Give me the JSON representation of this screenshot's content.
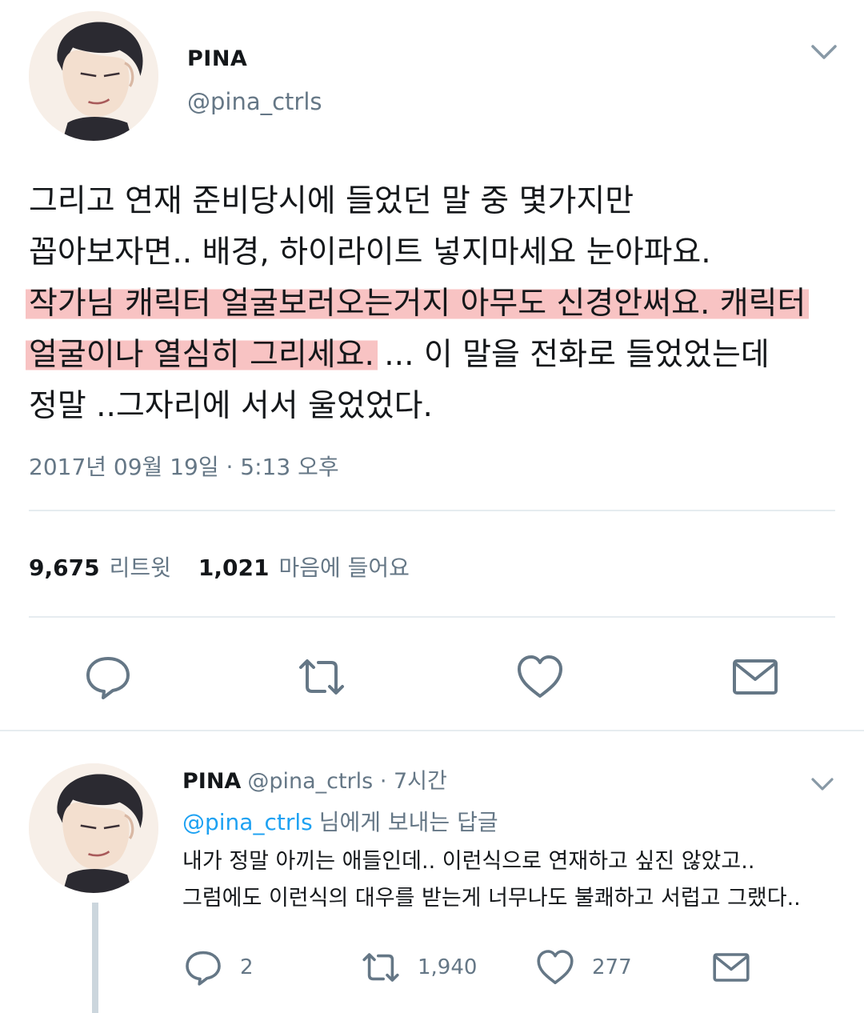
{
  "tweet": {
    "author_name": "PINA",
    "author_handle": "@pina_ctrls",
    "text_lines": [
      {
        "before": "그리고 연재 준비당시에 들었던 말 중 몇가지만",
        "marked": "",
        "after": ""
      },
      {
        "before": "꼽아보자면.. 배경, 하이라이트 넣지마세요 눈아파요.",
        "marked": "",
        "after": ""
      },
      {
        "before": "",
        "marked": "작가님 캐릭터 얼굴보러오는거지 아무도 신경안써요. 캐릭터",
        "after": ""
      },
      {
        "before": "",
        "marked": "얼굴이나 열심히 그리세요.",
        "after": " ... 이 말을 전화로 들었었는데"
      },
      {
        "before": "정말 ..그자리에 서서 울었었다.",
        "marked": "",
        "after": ""
      }
    ],
    "timestamp": "2017년 09월 19일 · 5:13 오후",
    "retweet_count": "9,675",
    "retweet_label": "리트윗",
    "like_count": "1,021",
    "like_label": "마음에 들어요",
    "icons": {
      "menu": "chevron-down-icon",
      "reply": "reply-icon",
      "retweet": "retweet-icon",
      "like": "heart-icon",
      "dm": "mail-icon"
    }
  },
  "reply": {
    "author_name": "PINA",
    "author_handle": "@pina_ctrls",
    "time": "· 7시간",
    "reply_to_handle": "@pina_ctrls",
    "reply_to_suffix": "님에게 보내는 답글",
    "text_lines": [
      "내가 정말 아끼는 애들인데.. 이런식으로 연재하고 싶진 않았고..",
      "그럼에도 이런식의 대우를 받는게 너무나도 불쾌하고 서럽고 그랬다.."
    ],
    "reply_count": "2",
    "retweet_count": "1,940",
    "like_count": "277"
  },
  "colors": {
    "text": "#14171a",
    "secondary": "#657786",
    "link": "#1da1f2",
    "highlight": "#f39292",
    "divider": "#e6ecf0"
  }
}
